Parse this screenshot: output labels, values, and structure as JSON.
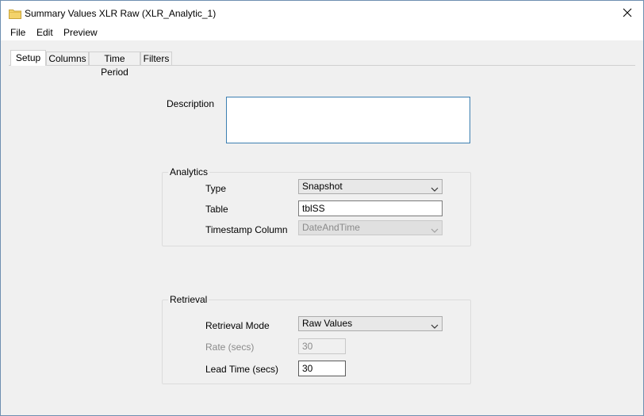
{
  "window": {
    "title": "Summary Values XLR Raw (XLR_Analytic_1)",
    "title_icon": "folder-icon",
    "close_icon": "close-icon"
  },
  "menu": [
    "File",
    "Edit",
    "Preview"
  ],
  "tabs": [
    {
      "label": "Setup",
      "active": true
    },
    {
      "label": "Columns",
      "active": false
    },
    {
      "label": "Time Period",
      "active": false
    },
    {
      "label": "Filters",
      "active": false
    }
  ],
  "setup": {
    "description_label": "Description",
    "description_value": "",
    "analytics": {
      "legend": "Analytics",
      "type_label": "Type",
      "type_value": "Snapshot",
      "table_label": "Table",
      "table_value": "tblSS",
      "timestamp_label": "Timestamp Column",
      "timestamp_value": "DateAndTime"
    },
    "retrieval": {
      "legend": "Retrieval",
      "mode_label": "Retrieval Mode",
      "mode_value": "Raw Values",
      "rate_label": "Rate (secs)",
      "rate_value": "30",
      "lead_label": "Lead Time (secs)",
      "lead_value": "30"
    }
  },
  "colors": {
    "window_border": "#6e8fb0",
    "focus_border": "#3c7fb1",
    "disabled_text": "#8a8a8a",
    "folder_icon": "#f3d36b"
  }
}
